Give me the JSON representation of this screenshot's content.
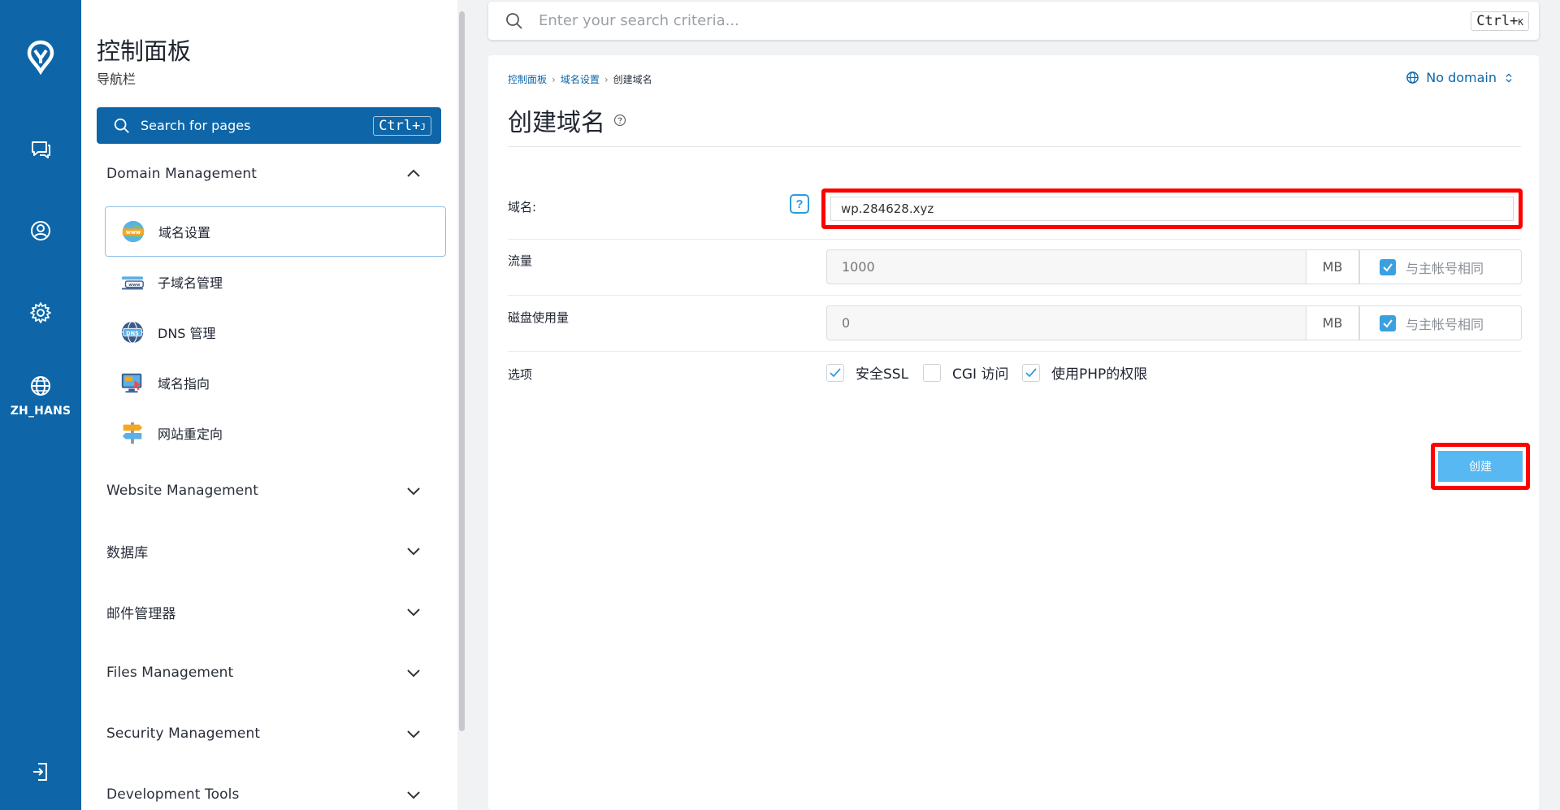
{
  "rail": {
    "lang_label": "ZH_HANS"
  },
  "nav": {
    "title": "控制面板",
    "subtitle": "导航栏",
    "search_label": "Search for pages",
    "search_shortcut_main": "Ctrl+",
    "search_shortcut_key": "J",
    "sections": [
      {
        "label": "Domain Management",
        "expanded": true
      },
      {
        "label": "Website Management",
        "expanded": false
      },
      {
        "label": "数据库",
        "expanded": false
      },
      {
        "label": "邮件管理器",
        "expanded": false
      },
      {
        "label": "Files Management",
        "expanded": false
      },
      {
        "label": "Security Management",
        "expanded": false
      },
      {
        "label": "Development Tools",
        "expanded": false
      }
    ],
    "domain_items": [
      {
        "label": "域名设置",
        "icon": "www-globe-icon",
        "active": true
      },
      {
        "label": "子域名管理",
        "icon": "subdomain-icon",
        "active": false
      },
      {
        "label": "DNS 管理",
        "icon": "dns-icon",
        "active": false
      },
      {
        "label": "域名指向",
        "icon": "domain-pointer-icon",
        "active": false
      },
      {
        "label": "网站重定向",
        "icon": "signpost-icon",
        "active": false
      }
    ]
  },
  "topbar": {
    "search_placeholder": "Enter your search criteria...",
    "shortcut_main": "Ctrl+",
    "shortcut_key": "K"
  },
  "main": {
    "breadcrumb": [
      "控制面板",
      "域名设置",
      "创建域名"
    ],
    "domain_selector": "No domain",
    "page_title": "创建域名",
    "form": {
      "domain_label": "域名:",
      "domain_value": "wp.284628.xyz",
      "help_glyph": "?",
      "traffic_label": "流量",
      "traffic_placeholder": "1000",
      "traffic_unit": "MB",
      "traffic_same_label": "与主帐号相同",
      "traffic_same_checked": true,
      "disk_label": "磁盘使用量",
      "disk_placeholder": "0",
      "disk_unit": "MB",
      "disk_same_label": "与主帐号相同",
      "disk_same_checked": true,
      "options_label": "选项",
      "options": [
        {
          "label": "安全SSL",
          "checked": true
        },
        {
          "label": "CGI 访问",
          "checked": false
        },
        {
          "label": "使用PHP的权限",
          "checked": true
        }
      ],
      "submit_label": "创建"
    }
  },
  "colors": {
    "brand": "#0e66a8",
    "accent_button": "#57b8f2",
    "highlight": "#ff0000"
  }
}
